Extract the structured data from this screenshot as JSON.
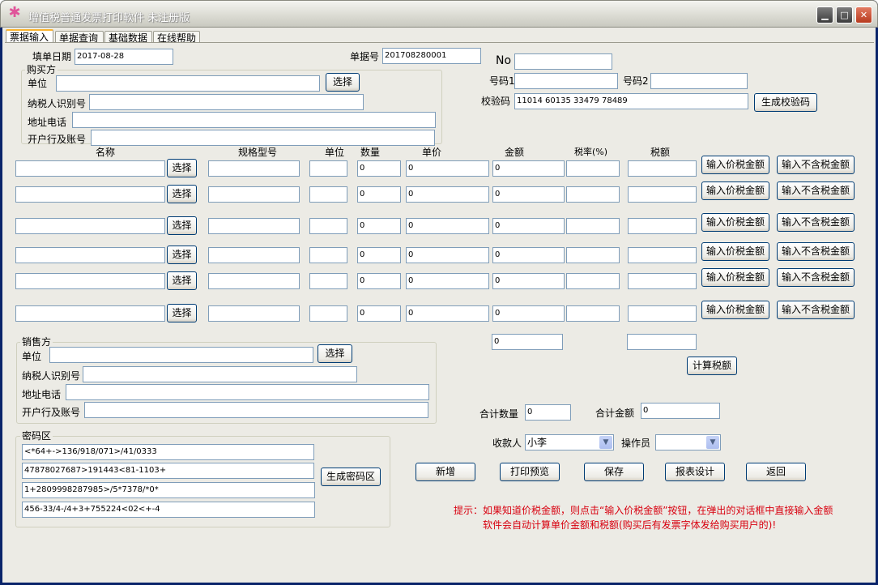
{
  "window": {
    "title": "增值税普通发票打印软件 未注册版",
    "icon": "flower-icon",
    "controls": [
      "minimize-icon",
      "maximize-icon",
      "close-icon"
    ]
  },
  "tabs": [
    "票据输入",
    "单据查询",
    "基础数据",
    "在线帮助"
  ],
  "header": {
    "date_label": "填单日期",
    "date_value": "2017-08-28",
    "docno_label": "单据号",
    "docno_value": "201708280001",
    "no_label": "No",
    "no_value": "",
    "code1_label": "号码1",
    "code1_value": "",
    "code2_label": "号码2",
    "code2_value": "",
    "check_label": "校验码",
    "check_value": "11014 60135 33479 78489",
    "gen_check_button": "生成校验码"
  },
  "buyer": {
    "title": "购买方",
    "unit_label": "单位",
    "unit_value": "",
    "select_button": "选择",
    "taxid_label": "纳税人识别号",
    "taxid_value": "",
    "addr_label": "地址电话",
    "addr_value": "",
    "bank_label": "开户行及账号",
    "bank_value": ""
  },
  "items": {
    "headers": {
      "name": "名称",
      "spec": "规格型号",
      "unit": "单位",
      "qty": "数量",
      "price": "单价",
      "amount": "金额",
      "rate": "税率(%)",
      "tax": "税额"
    },
    "select_button": "选择",
    "incl_button": "输入价税金额",
    "excl_button": "输入不含税金额",
    "rows": [
      {
        "name": "",
        "spec": "",
        "unit": "",
        "qty": "0",
        "price": "0",
        "amount": "0",
        "rate": "",
        "tax": ""
      },
      {
        "name": "",
        "spec": "",
        "unit": "",
        "qty": "0",
        "price": "0",
        "amount": "0",
        "rate": "",
        "tax": ""
      },
      {
        "name": "",
        "spec": "",
        "unit": "",
        "qty": "0",
        "price": "0",
        "amount": "0",
        "rate": "",
        "tax": ""
      },
      {
        "name": "",
        "spec": "",
        "unit": "",
        "qty": "0",
        "price": "0",
        "amount": "0",
        "rate": "",
        "tax": ""
      },
      {
        "name": "",
        "spec": "",
        "unit": "",
        "qty": "0",
        "price": "0",
        "amount": "0",
        "rate": "",
        "tax": ""
      },
      {
        "name": "",
        "spec": "",
        "unit": "",
        "qty": "0",
        "price": "0",
        "amount": "0",
        "rate": "",
        "tax": ""
      }
    ],
    "total_amount": "0",
    "total_tax": "",
    "calc_tax_button": "计算税额"
  },
  "seller": {
    "title": "销售方",
    "unit_label": "单位",
    "unit_value": "",
    "select_button": "选择",
    "taxid_label": "纳税人识别号",
    "taxid_value": "",
    "addr_label": "地址电话",
    "addr_value": "",
    "bank_label": "开户行及账号",
    "bank_value": ""
  },
  "cipher": {
    "title": "密码区",
    "lines": [
      "<*64+->136/918/071>/41/0333",
      "47878027687>191443<81-1103+",
      "1+2809998287985>/5*7378/*0*",
      "456-33/4-/4+3+755224<02<+-4"
    ],
    "gen_button": "生成密码区"
  },
  "totals": {
    "qty_label": "合计数量",
    "qty_value": "0",
    "amount_label": "合计金额",
    "amount_value": "0"
  },
  "payee": {
    "label": "收款人",
    "value": "小李"
  },
  "operator": {
    "label": "操作员",
    "value": ""
  },
  "actions": {
    "new": "新增",
    "preview": "打印预览",
    "save": "保存",
    "design": "报表设计",
    "back": "返回"
  },
  "hint": {
    "line1": "提示：如果知道价税金额，则点击“输入价税金额”按钮，在弹出的对话框中直接输入金额",
    "line2": "软件会自动计算单价金额和税额(购买后有发票字体发给购买用户的)!"
  }
}
